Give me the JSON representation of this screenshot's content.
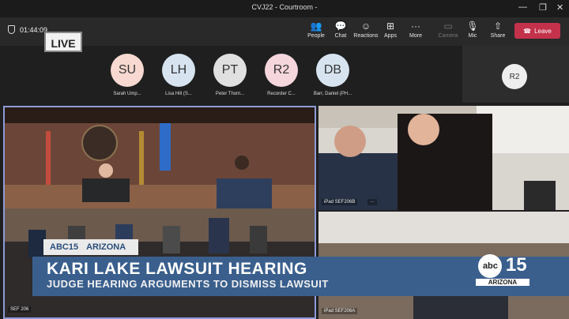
{
  "window": {
    "title": "CVJ22 - Courtroom -",
    "minimize": "—",
    "restore": "❐",
    "close": "✕"
  },
  "toolbar": {
    "timer": "01:44:09",
    "buttons": [
      {
        "label": "People",
        "icon": "👥"
      },
      {
        "label": "Chat",
        "icon": "💬"
      },
      {
        "label": "Reactions",
        "icon": "☺"
      },
      {
        "label": "Apps",
        "icon": "⊞"
      },
      {
        "label": "More",
        "icon": "···"
      },
      {
        "label": "Camera",
        "icon": "▭"
      },
      {
        "label": "Mic",
        "icon": "🎙"
      },
      {
        "label": "Share",
        "icon": "⇧"
      }
    ],
    "leave": "Leave",
    "leave_icon": "☎"
  },
  "live_badge": "LIVE",
  "participants": [
    {
      "initials": "SU",
      "name": "Sarah Ump...",
      "color": "#f7d9d1"
    },
    {
      "initials": "LH",
      "name": "Lisa Hill (S...",
      "color": "#d7e4f0"
    },
    {
      "initials": "PT",
      "name": "Peter Thom...",
      "color": "#e0e0e0"
    },
    {
      "initials": "R2",
      "name": "Recorder C...",
      "color": "#f5d6dd"
    },
    {
      "initials": "DB",
      "name": "Barr, Daniel (PH...",
      "color": "#d7e4f0"
    }
  ],
  "side_tile": {
    "initials": "R2"
  },
  "videos": {
    "main_label": "SEF 206",
    "top_right_label": "iPad SEF206B",
    "top_right_more": "···",
    "bottom_right_label": "iPad SEF206A"
  },
  "news": {
    "station": "ABC15",
    "region": "ARIZONA",
    "headline": "KARI LAKE LAWSUIT HEARING",
    "subhead": "JUDGE HEARING ARGUMENTS TO DISMISS LAWSUIT",
    "logo_abc": "abc",
    "logo_num": "15",
    "logo_region": "ARIZONA"
  }
}
